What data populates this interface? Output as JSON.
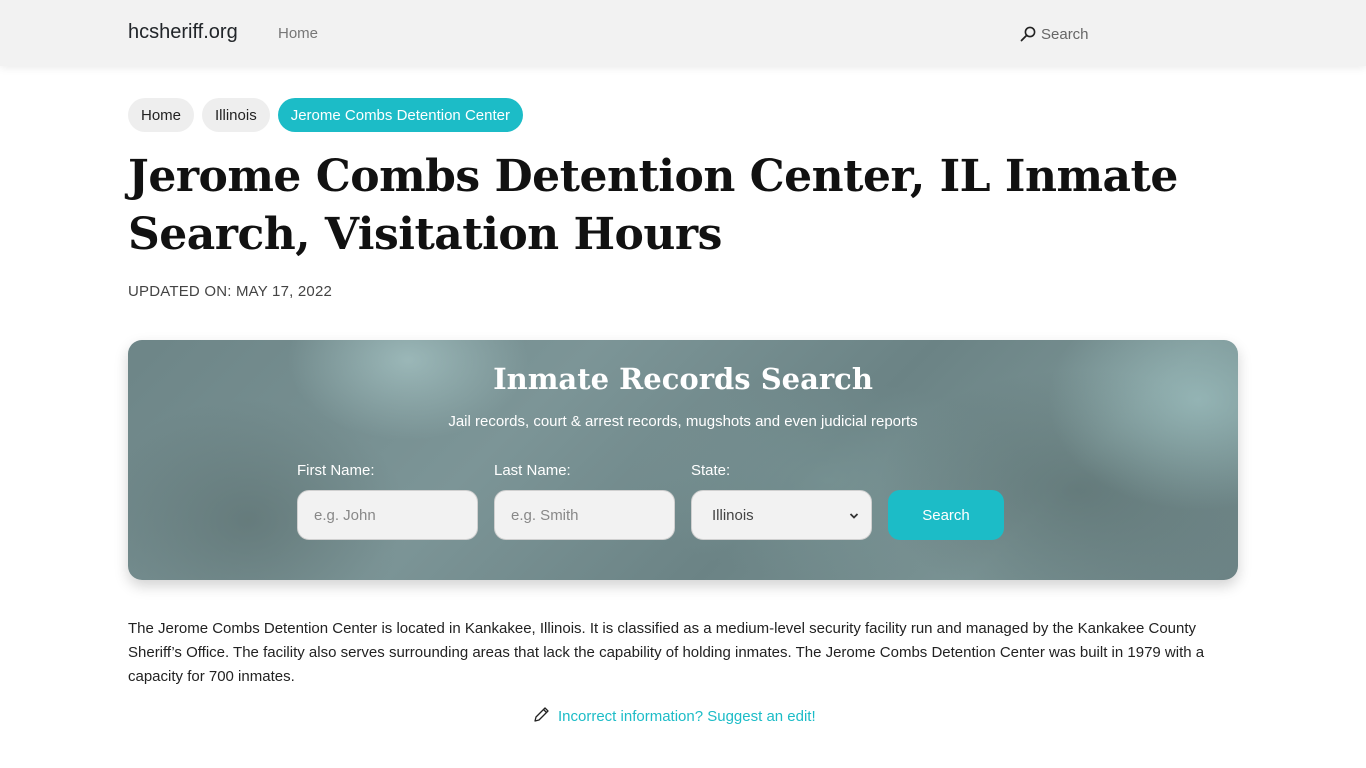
{
  "header": {
    "brand": "hcsheriff.org",
    "nav_home": "Home",
    "search_label": "Search"
  },
  "breadcrumb": [
    {
      "label": "Home"
    },
    {
      "label": "Illinois"
    },
    {
      "label": "Jerome Combs Detention Center",
      "active": true
    }
  ],
  "page": {
    "title": "Jerome Combs Detention Center, IL Inmate Search, Visitation Hours",
    "updated": "UPDATED ON: MAY 17, 2022"
  },
  "search_panel": {
    "title": "Inmate Records Search",
    "subtitle": "Jail records, court & arrest records, mugshots and even judicial reports",
    "first_name": {
      "label": "First Name:",
      "placeholder": "e.g. John",
      "value": ""
    },
    "last_name": {
      "label": "Last Name:",
      "placeholder": "e.g. Smith",
      "value": ""
    },
    "state": {
      "label": "State:",
      "selected": "Illinois"
    },
    "button_label": "Search"
  },
  "description": "The Jerome Combs Detention Center is located in Kankakee, Illinois. It is classified as a medium-level security facility run and managed by the Kankakee County Sheriff’s Office. The facility also serves surrounding areas that lack the capability of holding inmates. The Jerome Combs Detention Center was built in 1979 with a capacity for 700 inmates.",
  "edit_link": "Incorrect information? Suggest an edit!",
  "colors": {
    "accent": "#1cbcc7",
    "header_bg": "#f2f2f2"
  }
}
